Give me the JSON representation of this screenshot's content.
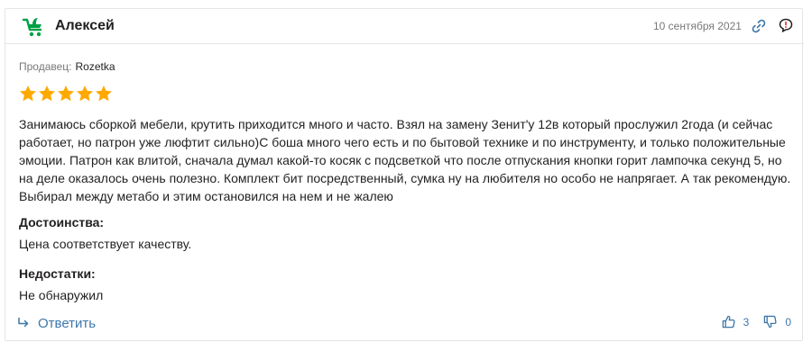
{
  "review": {
    "author": "Алексей",
    "date": "10 сентября 2021",
    "seller_label": "Продавец:",
    "seller_name": "Rozetka",
    "rating": 5,
    "rating_max": 5,
    "text": "Занимаюсь сборкой мебели, крутить приходится много и часто. Взял на замену Зенит'у 12в который прослужил 2года (и сейчас работает, но патрон уже люфтит сильно)С боша много чего есть и по бытовой технике и по инструменту, и только положительные эмоции. Патрон как влитой, сначала думал какой-то косяк с подсветкой что после отпускания кнопки горит лампочка секунд 5, но на деле оказалось очень полезно. Комплект бит посредственный, сумка ну на любителя но особо не напрягает. А так рекомендую. Выбирал между метабо и этим остановился на нем и не жалею",
    "pros_label": "Достоинства:",
    "pros_text": "Цена соответствует качеству.",
    "cons_label": "Недостатки:",
    "cons_text": "Не обнаружил",
    "reply_label": "Ответить",
    "likes": "3",
    "dislikes": "0"
  },
  "icons": {
    "avatar": "cart-avatar-icon",
    "link": "link-icon",
    "flag": "flag-icon",
    "star": "star-icon",
    "reply": "reply-arrow-icon",
    "like": "thumbs-up-icon",
    "dislike": "thumbs-down-icon"
  },
  "colors": {
    "brand_green": "#00a046",
    "star": "#ffa900",
    "link": "#3e77aa",
    "muted": "#797878",
    "text": "#221f1f"
  }
}
